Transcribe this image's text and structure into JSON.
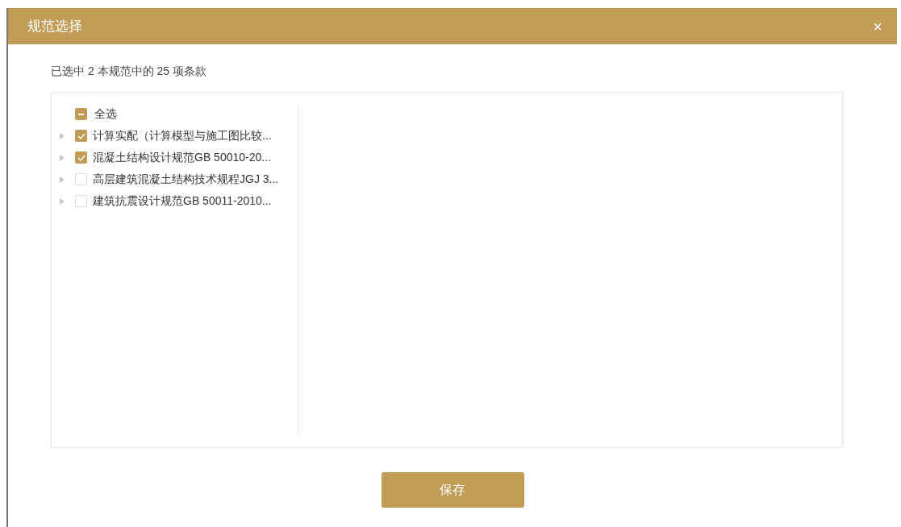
{
  "dialog": {
    "title": "规范选择",
    "close": "×"
  },
  "summary": "已选中 2 本规范中的 25 项条款",
  "tree": {
    "select_all": {
      "label": "全选",
      "indeterminate": true
    },
    "items": [
      {
        "label": "计算实配（计算模型与施工图比较...",
        "checked": true,
        "expanded": false
      },
      {
        "label": "混凝土结构设计规范GB 50010-20...",
        "checked": true,
        "expanded": false
      },
      {
        "label": "高层建筑混凝土结构技术规程JGJ 3...",
        "checked": false,
        "expanded": false
      },
      {
        "label": "建筑抗震设计规范GB 50011-2010...",
        "checked": false,
        "expanded": false
      }
    ]
  },
  "save_button": "保存"
}
